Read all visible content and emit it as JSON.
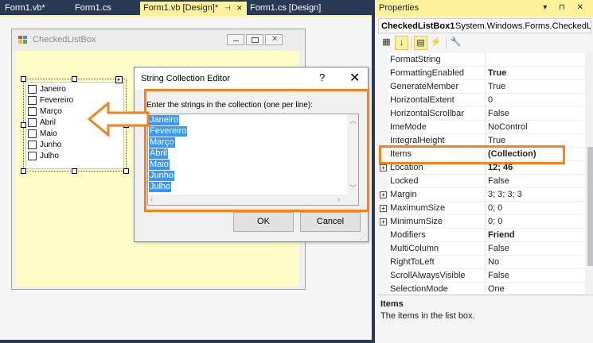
{
  "tabs": [
    {
      "label": "Form1.vb*",
      "active": false
    },
    {
      "label": "Form1.cs",
      "active": false
    },
    {
      "label": "Form1.vb [Design]*",
      "active": true
    },
    {
      "label": "Form1.cs [Design]",
      "active": false
    }
  ],
  "form": {
    "title": "CheckedListBox",
    "list_items": [
      "Janeiro",
      "Fevereiro",
      "Março",
      "Abril",
      "Maio",
      "Junho",
      "Julho"
    ]
  },
  "dialog": {
    "title": "String Collection Editor",
    "help": "?",
    "close": "✕",
    "prompt": "Enter the strings in the collection (one per line):",
    "lines": [
      "Janeiro",
      "Fevereiro",
      "Março",
      "Abril",
      "Maio",
      "Junho",
      "Julho"
    ],
    "ok_label": "OK",
    "cancel_label": "Cancel"
  },
  "properties": {
    "title": "Properties",
    "title_buttons": "▾ ⊓ ✕",
    "object_name": "CheckedListBox1",
    "object_type": "System.Windows.Forms.CheckedL",
    "rows": [
      {
        "name": "FormatString",
        "value": "",
        "bold": false,
        "expandable": false
      },
      {
        "name": "FormattingEnabled",
        "value": "True",
        "bold": true,
        "expandable": false
      },
      {
        "name": "GenerateMember",
        "value": "True",
        "bold": false,
        "expandable": false
      },
      {
        "name": "HorizontalExtent",
        "value": "0",
        "bold": false,
        "expandable": false
      },
      {
        "name": "HorizontalScrollbar",
        "value": "False",
        "bold": false,
        "expandable": false
      },
      {
        "name": "ImeMode",
        "value": "NoControl",
        "bold": false,
        "expandable": false
      },
      {
        "name": "IntegralHeight",
        "value": "True",
        "bold": false,
        "expandable": false
      },
      {
        "name": "Items",
        "value": "(Collection)",
        "bold": true,
        "expandable": false
      },
      {
        "name": "Location",
        "value": "12; 46",
        "bold": true,
        "expandable": true
      },
      {
        "name": "Locked",
        "value": "False",
        "bold": false,
        "expandable": false
      },
      {
        "name": "Margin",
        "value": "3; 3; 3; 3",
        "bold": false,
        "expandable": true
      },
      {
        "name": "MaximumSize",
        "value": "0; 0",
        "bold": false,
        "expandable": true
      },
      {
        "name": "MinimumSize",
        "value": "0; 0",
        "bold": false,
        "expandable": true
      },
      {
        "name": "Modifiers",
        "value": "Friend",
        "bold": true,
        "expandable": false
      },
      {
        "name": "MultiColumn",
        "value": "False",
        "bold": false,
        "expandable": false
      },
      {
        "name": "RightToLeft",
        "value": "No",
        "bold": false,
        "expandable": false
      },
      {
        "name": "ScrollAlwaysVisible",
        "value": "False",
        "bold": false,
        "expandable": false
      },
      {
        "name": "SelectionMode",
        "value": "One",
        "bold": false,
        "expandable": false
      }
    ],
    "description_title": "Items",
    "description_text": "The items in the list box."
  },
  "colors": {
    "annotation_orange": "#f7821c",
    "selection_blue": "#3399ff",
    "form_background": "#fffdc7",
    "vs_tab_dark": "#293955",
    "vs_active_yellow": "#fff29d"
  }
}
